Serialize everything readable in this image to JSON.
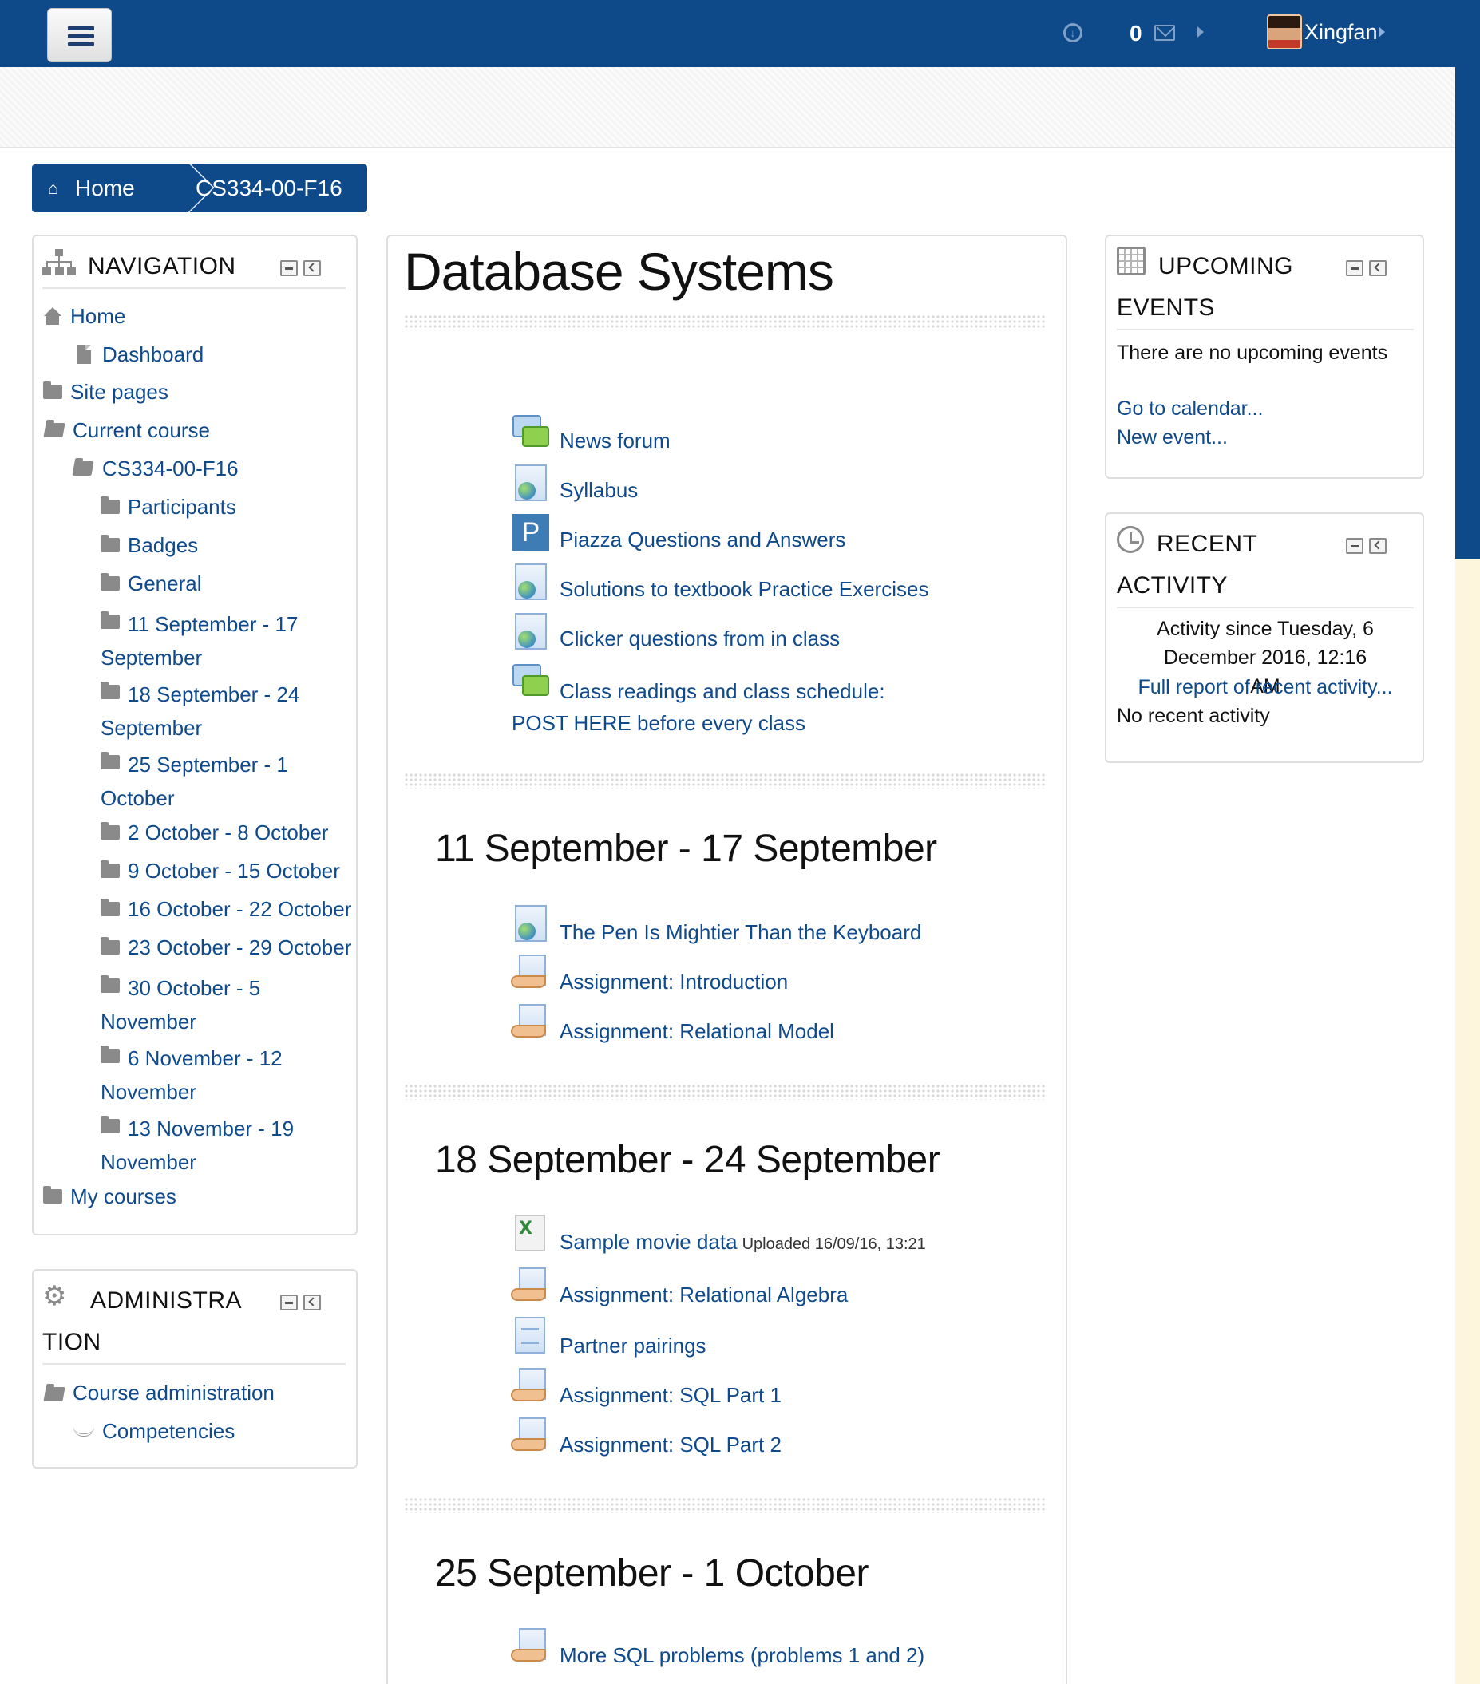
{
  "header": {
    "message_count": "0",
    "user_name": "Xingfan"
  },
  "breadcrumb": {
    "home": "Home",
    "course": "CS334-00-F16"
  },
  "navigation": {
    "title": "NAVIGATION",
    "home": "Home",
    "dashboard": "Dashboard",
    "site_pages": "Site pages",
    "current_course": "Current course",
    "course": "CS334-00-F16",
    "participants": "Participants",
    "badges": "Badges",
    "general": "General",
    "weeks": [
      "11 September - 17 September",
      "18 September - 24 September",
      "25 September - 1 October",
      "2 October - 8 October",
      "9 October - 15 October",
      "16 October - 22 October",
      "23 October - 29 October",
      "30 October - 5 November",
      "6 November - 12 November",
      "13 November - 19 November"
    ],
    "my_courses": "My courses"
  },
  "administration": {
    "title": "ADMINISTRATION",
    "course_admin": "Course administration",
    "competencies": "Competencies"
  },
  "main": {
    "course_title": "Database Systems",
    "general_activities": [
      "News forum",
      "Syllabus",
      "Piazza Questions and Answers",
      "Solutions to textbook Practice Exercises",
      "Clicker questions from in class",
      "Class readings and class schedule: POST HERE before every class"
    ],
    "sections": [
      {
        "title": "11 September - 17 September",
        "activities": [
          "The Pen Is Mightier Than the Keyboard",
          "Assignment: Introduction",
          "Assignment: Relational Model"
        ]
      },
      {
        "title": "18 September - 24 September",
        "activities": [
          "Sample movie data",
          "Assignment: Relational Algebra",
          "Partner pairings",
          "Assignment: SQL Part 1",
          "Assignment: SQL Part 2"
        ],
        "file_meta": "Uploaded 16/09/16, 13:21"
      },
      {
        "title": "25 September - 1 October",
        "activities": [
          "More SQL problems (problems 1 and 2)"
        ]
      }
    ]
  },
  "upcoming_events": {
    "title": "UPCOMING EVENTS",
    "empty_text": "There are no upcoming events",
    "go_to_calendar": "Go to calendar...",
    "new_event": "New event..."
  },
  "recent_activity": {
    "title": "RECENT ACTIVITY",
    "since_text": "Activity since Tuesday, 6 December 2016, 12:16 AM",
    "full_report": "Full report of recent activity...",
    "none_text": "No recent activity"
  },
  "colors": {
    "brand_blue": "#0e4a8a",
    "link_blue": "#0f4a8c",
    "cream_strip": "#fdf6dc"
  }
}
